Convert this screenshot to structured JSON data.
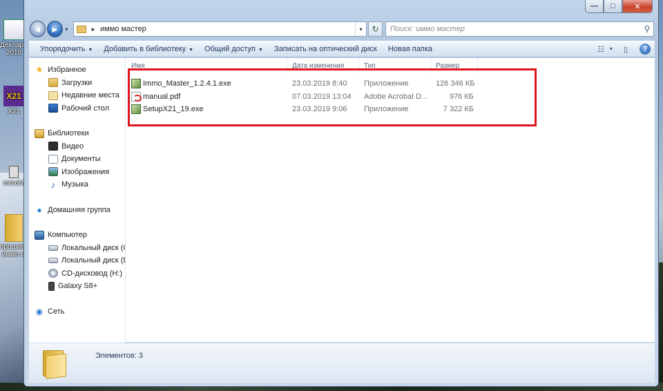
{
  "desktop": {
    "icons": [
      {
        "label": "Деклара\n2018"
      },
      {
        "label": "X21"
      },
      {
        "label": "mmoM"
      },
      {
        "label": "прошивка\nиммо м"
      }
    ]
  },
  "window": {
    "caption_buttons": {
      "minimize": "—",
      "maximize": "□",
      "close": "✕"
    }
  },
  "navbar": {
    "back_glyph": "◄",
    "forward_glyph": "►",
    "history_glyph": "▾",
    "address_sep": "►",
    "address_path": "иммо мастер",
    "address_dropdown": "▾",
    "refresh_glyph": "↻",
    "search_placeholder": "Поиск: иммо мастер",
    "search_glyph": "⚲"
  },
  "toolbar": {
    "items": [
      {
        "label": "Упорядочить",
        "caret": "▼"
      },
      {
        "label": "Добавить в библиотеку",
        "caret": "▼"
      },
      {
        "label": "Общий доступ",
        "caret": "▼"
      },
      {
        "label": "Записать на оптический диск",
        "caret": ""
      },
      {
        "label": "Новая папка",
        "caret": ""
      }
    ],
    "view_glyph": "☷",
    "view_caret": "▼",
    "pane_glyph": "▯",
    "help_glyph": "?"
  },
  "sidebar": {
    "favorites": {
      "label": "Избранное",
      "items": [
        "Загрузки",
        "Недавние места",
        "Рабочий стол"
      ]
    },
    "libraries": {
      "label": "Библиотеки",
      "items": [
        "Видео",
        "Документы",
        "Изображения",
        "Музыка"
      ]
    },
    "homegroup": {
      "label": "Домашняя группа"
    },
    "computer": {
      "label": "Компьютер",
      "items": [
        "Локальный диск (C",
        "Локальный диск (D",
        "CD-дисковод (H:)",
        "Galaxy S8+"
      ]
    },
    "network": {
      "label": "Сеть"
    }
  },
  "columns": {
    "name": "Имя",
    "modified": "Дата изменения",
    "type": "Тип",
    "size": "Размер"
  },
  "files": [
    {
      "name": "Immo_Master_1.2.4.1.exe",
      "modified": "23.03.2019 8:40",
      "type": "Приложение",
      "size": "126 346 КБ",
      "icon": "exe-icon"
    },
    {
      "name": "manual.pdf",
      "modified": "07.03.2019 13:04",
      "type": "Adobe Acrobat D...",
      "size": "976 КБ",
      "icon": "pdf-icon"
    },
    {
      "name": "SetupX21_19.exe",
      "modified": "23.03.2019 9:06",
      "type": "Приложение",
      "size": "7 322 КБ",
      "icon": "exe-icon"
    }
  ],
  "details": {
    "item_count": "Элементов: 3"
  },
  "colors": {
    "highlight": "#e0141c",
    "accent": "#1e395b"
  }
}
